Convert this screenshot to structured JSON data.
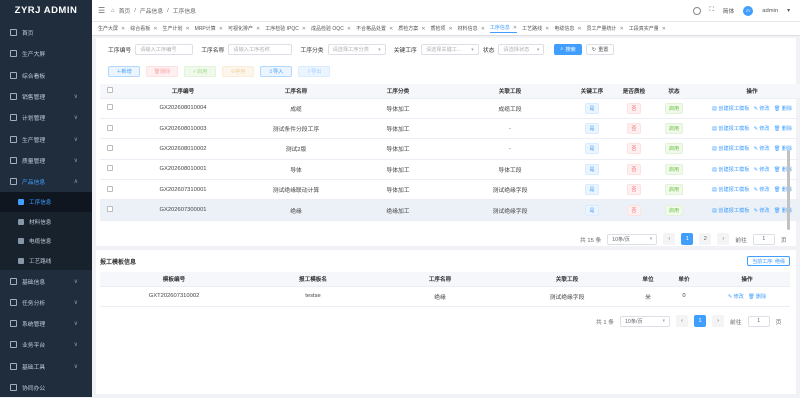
{
  "app": {
    "title": "ZYRJ ADMIN"
  },
  "sidebar": {
    "items": [
      {
        "label": "首页",
        "arrow": ""
      },
      {
        "label": "生产大屏",
        "arrow": ""
      },
      {
        "label": "综合看板",
        "arrow": ""
      },
      {
        "label": "销售管理",
        "arrow": "∨"
      },
      {
        "label": "计划管理",
        "arrow": "∨"
      },
      {
        "label": "生产管理",
        "arrow": "∨"
      },
      {
        "label": "质量管理",
        "arrow": "∨"
      },
      {
        "label": "产品信息",
        "arrow": "∧"
      }
    ],
    "submenu": [
      {
        "label": "工序信息"
      },
      {
        "label": "材料信息"
      },
      {
        "label": "电缆信息"
      },
      {
        "label": "工艺路线"
      }
    ],
    "items2": [
      {
        "label": "基础信息",
        "arrow": "∨"
      },
      {
        "label": "任务分析",
        "arrow": "∨"
      },
      {
        "label": "系统管理",
        "arrow": "∨"
      },
      {
        "label": "业务平台",
        "arrow": "∨"
      },
      {
        "label": "基础工具",
        "arrow": "∨"
      },
      {
        "label": "协同办公",
        "arrow": ""
      }
    ]
  },
  "header": {
    "breadcrumb": [
      "首页",
      "产品信息",
      "工序信息"
    ],
    "fullscreen": "⛶",
    "help": "?",
    "user": "admin",
    "lang": "简体"
  },
  "tabs": [
    {
      "label": "生产大屏"
    },
    {
      "label": "综合看板"
    },
    {
      "label": "生产计划"
    },
    {
      "label": "MRP计算"
    },
    {
      "label": "可视化排产"
    },
    {
      "label": "工序检验 IPQC"
    },
    {
      "label": "成品检验 OQC"
    },
    {
      "label": "不合格品处置"
    },
    {
      "label": "质检方案"
    },
    {
      "label": "质检项"
    },
    {
      "label": "材料信息"
    },
    {
      "label": "工序信息",
      "active": true
    },
    {
      "label": "工艺路线"
    },
    {
      "label": "电缆信息"
    },
    {
      "label": "员工产量统计"
    },
    {
      "label": "工段真实产量"
    }
  ],
  "filters": {
    "code_label": "工序编号",
    "code_placeholder": "请输入工序编号",
    "name_label": "工序名称",
    "name_placeholder": "请输入工序名称",
    "cat_label": "工序分类",
    "cat_placeholder": "请选择工序分类",
    "key_label": "关键工序",
    "key_placeholder": "请选择关键工...",
    "status_label": "状态",
    "status_placeholder": "请选择状态",
    "search": "搜索",
    "reset": "重置"
  },
  "toolbar": {
    "add": "新增",
    "delete": "删除",
    "enable": "启用",
    "disable": "停用",
    "import": "导入",
    "export": "导出"
  },
  "table": {
    "columns": [
      "工序编号",
      "工序名称",
      "工序分类",
      "关联工段",
      "关键工序",
      "是否质检",
      "状态",
      "操作"
    ],
    "rows": [
      {
        "code": "GX202608010004",
        "name": "成缆",
        "cat": "导体加工",
        "seg": "成缆工段",
        "key": "是",
        "qc": "否",
        "status": "启用"
      },
      {
        "code": "GX202608010003",
        "name": "测试条件分段工序",
        "cat": "导体加工",
        "seg": "-",
        "key": "是",
        "qc": "否",
        "status": "启用"
      },
      {
        "code": "GX202608010002",
        "name": "测试2版",
        "cat": "导体加工",
        "seg": "-",
        "key": "是",
        "qc": "否",
        "status": "启用"
      },
      {
        "code": "GX202608010001",
        "name": "导体",
        "cat": "导体加工",
        "seg": "导体工段",
        "key": "是",
        "qc": "否",
        "status": "启用"
      },
      {
        "code": "GX202607310001",
        "name": "测试绝缘联动计算",
        "cat": "导体加工",
        "seg": "测试绝缘字段",
        "key": "是",
        "qc": "否",
        "status": "启用"
      },
      {
        "code": "GX202607300001",
        "name": "绝缘",
        "cat": "绝缘加工",
        "seg": "测试绝缘字段",
        "key": "是",
        "qc": "否",
        "status": "启用"
      }
    ],
    "op_create": "创建报工模板",
    "op_edit": "修改",
    "op_delete": "删除"
  },
  "pager1": {
    "total": "共 15 条",
    "size": "10条/页",
    "pages": [
      "1",
      "2"
    ],
    "goto": "前往",
    "page": "1",
    "unit": "页"
  },
  "section2": {
    "title": "报工模板信息",
    "button": "当前工序: 绝缘"
  },
  "table2": {
    "columns": [
      "模板编号",
      "报工模板名",
      "工序名称",
      "关联工段",
      "单位",
      "单价",
      "操作"
    ],
    "rows": [
      {
        "code": "GXT202607310002",
        "name": "testse",
        "proc": "绝缘",
        "seg": "测试绝缘字段",
        "unit": "米",
        "price": "0"
      }
    ],
    "op_edit": "修改",
    "op_delete": "删除"
  },
  "pager2": {
    "total": "共 1 条",
    "size": "10条/页",
    "pages": [
      "1"
    ],
    "goto": "前往",
    "page": "1",
    "unit": "页"
  },
  "colors": {
    "primary": "#409eff",
    "sidebar": "#1f2d3d"
  }
}
